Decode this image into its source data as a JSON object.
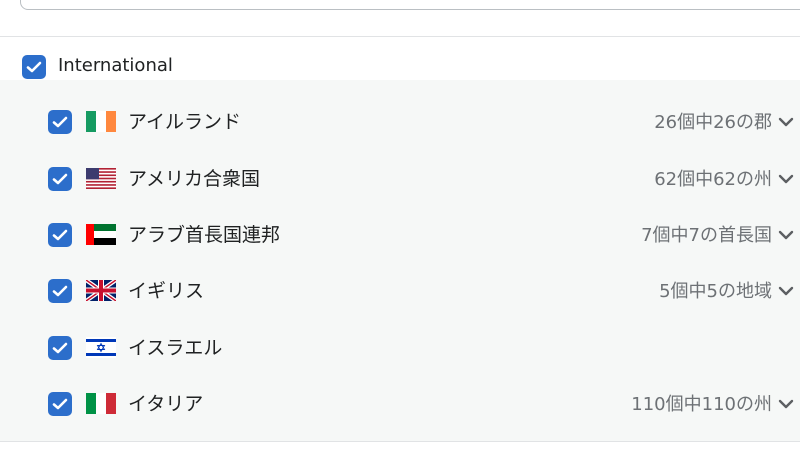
{
  "group": {
    "label": "International",
    "checked": true
  },
  "countries": [
    {
      "name": "アイルランド",
      "flag": "ireland-flag-icon",
      "count": "26個中26の郡",
      "checked": true,
      "has_chevron": true
    },
    {
      "name": "アメリカ合衆国",
      "flag": "usa-flag-icon",
      "count": "62個中62の州",
      "checked": true,
      "has_chevron": true
    },
    {
      "name": "アラブ首長国連邦",
      "flag": "uae-flag-icon",
      "count": "7個中7の首長国",
      "checked": true,
      "has_chevron": true
    },
    {
      "name": "イギリス",
      "flag": "uk-flag-icon",
      "count": "5個中5の地域",
      "checked": true,
      "has_chevron": true
    },
    {
      "name": "イスラエル",
      "flag": "israel-flag-icon",
      "count": "",
      "checked": true,
      "has_chevron": false
    },
    {
      "name": "イタリア",
      "flag": "italy-flag-icon",
      "count": "110個中110の州",
      "checked": true,
      "has_chevron": true
    }
  ],
  "colors": {
    "checkbox": "#2c6ecb",
    "panel_bg": "#f6f8f7",
    "muted_text": "#6d7175"
  }
}
